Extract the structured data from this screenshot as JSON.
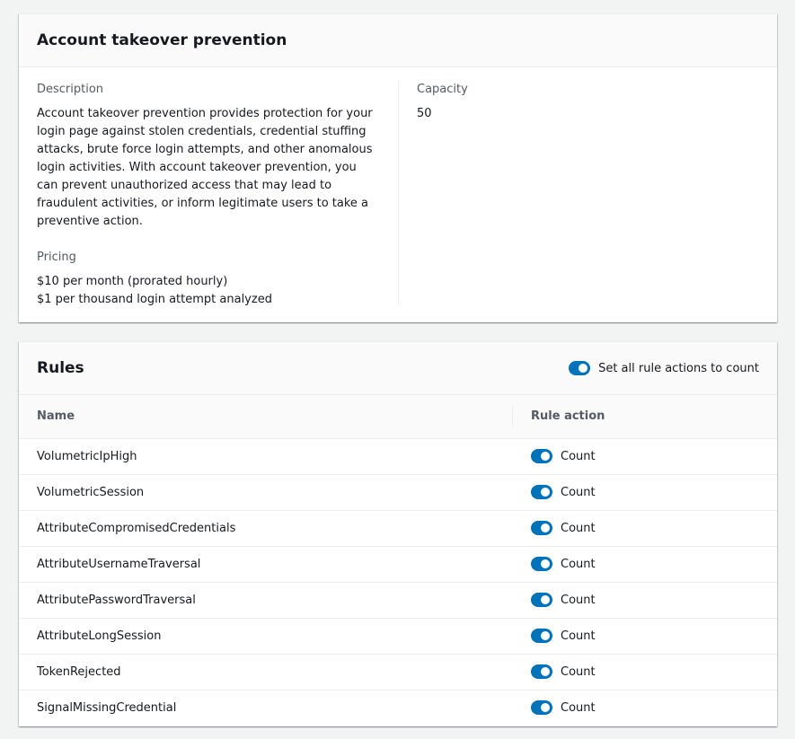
{
  "overview": {
    "title": "Account takeover prevention",
    "description_label": "Description",
    "description_text": "Account takeover prevention provides protection for your login page against stolen credentials, credential stuffing attacks, brute force login attempts, and other anomalous login activities. With account takeover prevention, you can prevent unauthorized access that may lead to fraudulent activities, or inform legitimate users to take a preventive action.",
    "pricing_label": "Pricing",
    "pricing_lines": [
      "$10 per month (prorated hourly)",
      "$1 per thousand login attempt analyzed"
    ],
    "capacity_label": "Capacity",
    "capacity_value": "50"
  },
  "rules": {
    "title": "Rules",
    "set_all_label": "Set all rule actions to count",
    "set_all_on": true,
    "columns": [
      "Name",
      "Rule action"
    ],
    "items": [
      {
        "name": "VolumetricIpHigh",
        "action": "Count",
        "on": true
      },
      {
        "name": "VolumetricSession",
        "action": "Count",
        "on": true
      },
      {
        "name": "AttributeCompromisedCredentials",
        "action": "Count",
        "on": true
      },
      {
        "name": "AttributeUsernameTraversal",
        "action": "Count",
        "on": true
      },
      {
        "name": "AttributePasswordTraversal",
        "action": "Count",
        "on": true
      },
      {
        "name": "AttributeLongSession",
        "action": "Count",
        "on": true
      },
      {
        "name": "TokenRejected",
        "action": "Count",
        "on": true
      },
      {
        "name": "SignalMissingCredential",
        "action": "Count",
        "on": true
      }
    ]
  },
  "colors": {
    "toggle_on": "#0073bb",
    "background": "#f2f3f3",
    "panel": "#ffffff",
    "header": "#fafafa"
  }
}
